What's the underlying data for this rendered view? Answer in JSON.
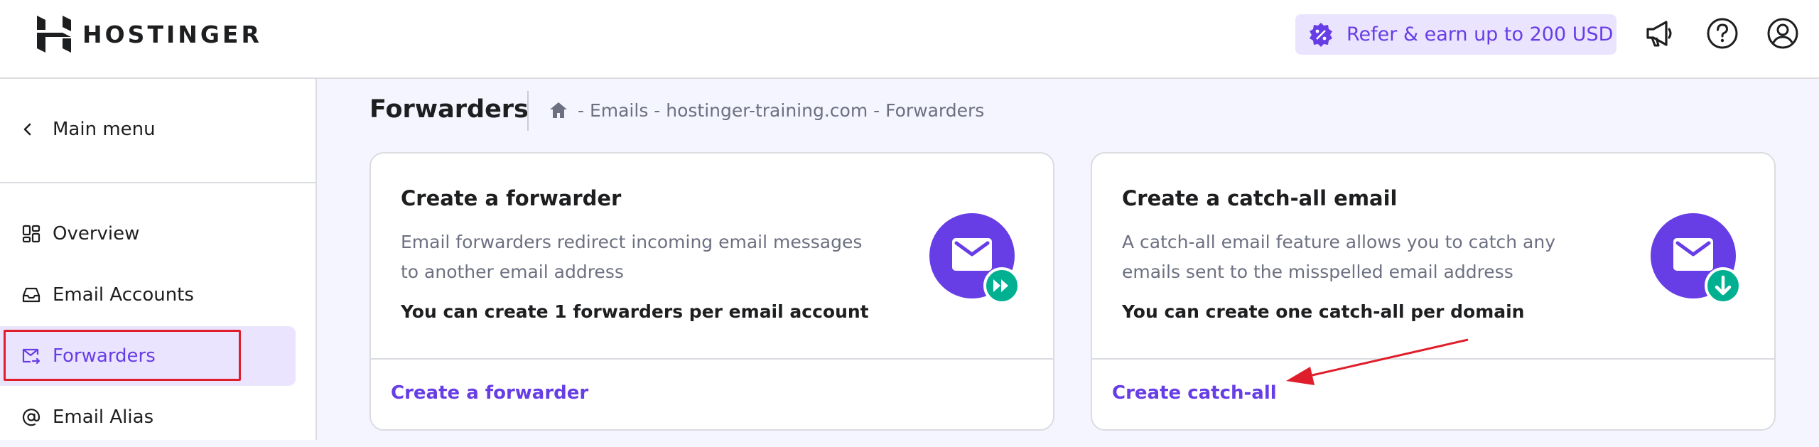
{
  "header": {
    "logo_text": "HOSTINGER",
    "refer_label": "Refer & earn up to 200 USD",
    "icons": [
      "megaphone-icon",
      "help-icon",
      "account-icon"
    ]
  },
  "sidebar": {
    "back_label": "Main menu",
    "items": [
      {
        "label": "Overview",
        "icon": "overview-icon"
      },
      {
        "label": "Email Accounts",
        "icon": "inbox-icon"
      },
      {
        "label": "Forwarders",
        "icon": "forward-mail-icon",
        "active": true
      },
      {
        "label": "Email Alias",
        "icon": "at-icon"
      }
    ]
  },
  "page": {
    "title": "Forwarders",
    "breadcrumb": "- Emails - hostinger-training.com - Forwarders"
  },
  "cards": [
    {
      "title": "Create a forwarder",
      "description": "Email forwarders redirect incoming email messages to another email address",
      "note": "You can create 1 forwarders per email account",
      "link": "Create a forwarder",
      "icon": "mail-forward-illustration"
    },
    {
      "title": "Create a catch-all email",
      "description": "A catch-all email feature allows you to catch any emails sent to the misspelled email address",
      "note": "You can create one catch-all per domain",
      "link": "Create catch-all",
      "icon": "mail-download-illustration"
    }
  ],
  "colors": {
    "brand": "#673de6",
    "brand_light": "#ebe4ff",
    "accent_green": "#00b090",
    "annotation_red": "#e01d2b"
  }
}
